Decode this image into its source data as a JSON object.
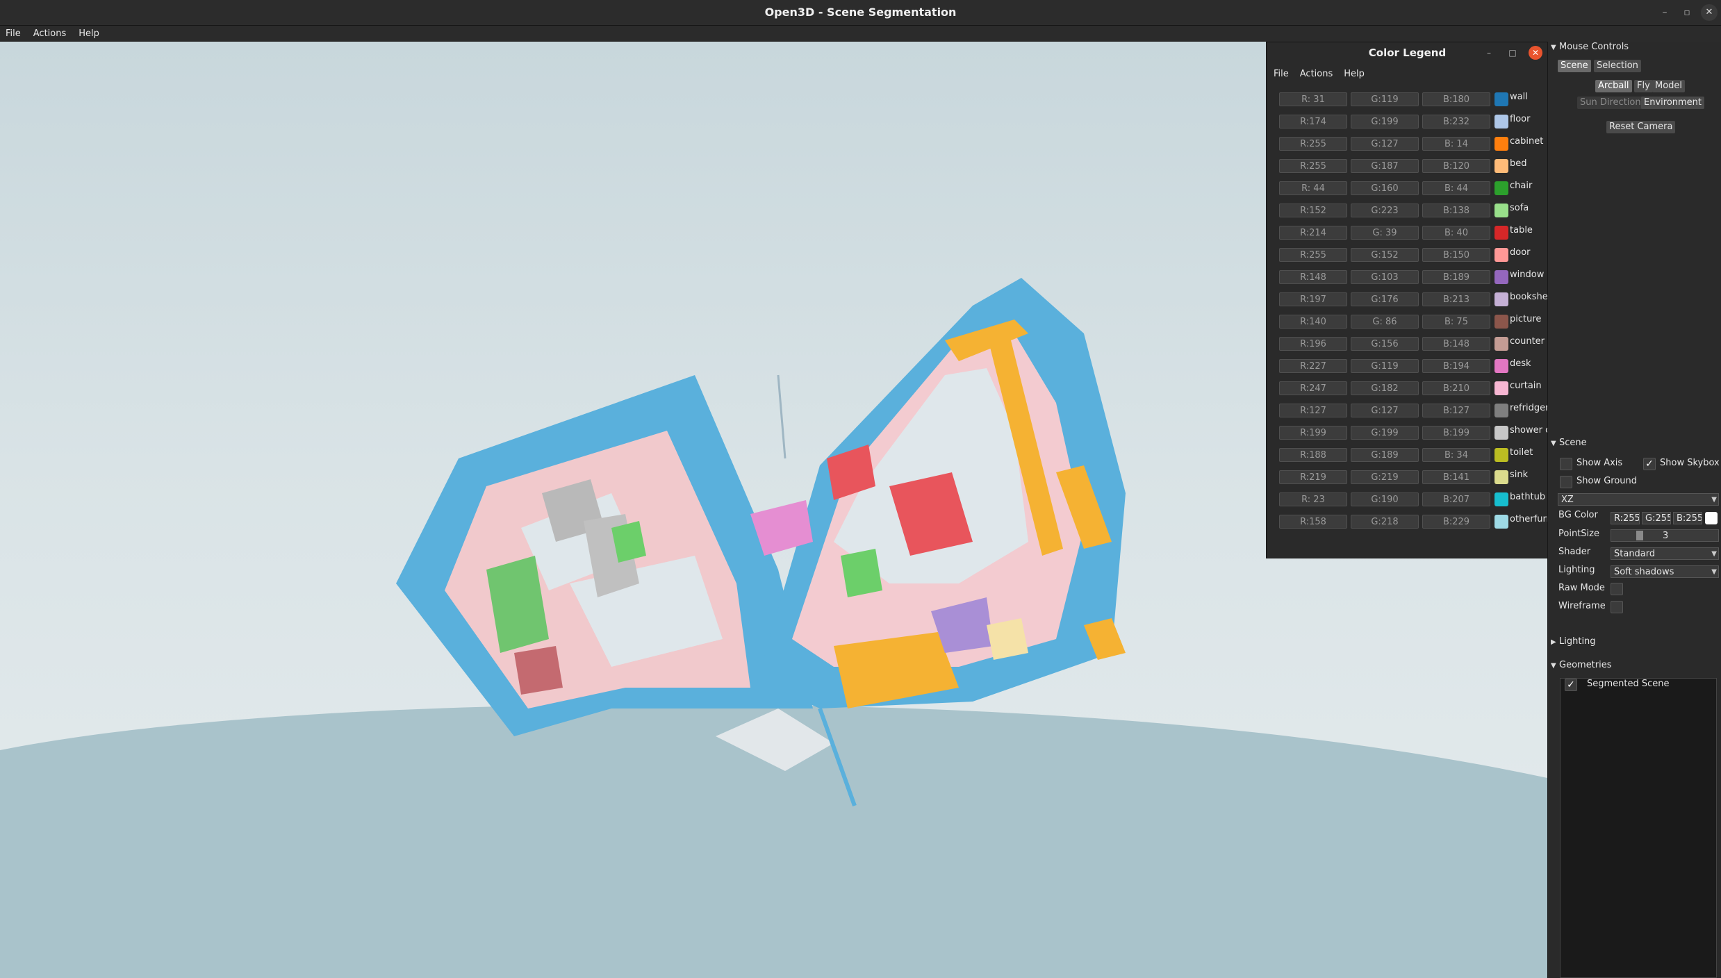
{
  "window": {
    "title": "Open3D - Scene Segmentation",
    "minimize": "–",
    "maximize": "▫",
    "close": "✕"
  },
  "menubar": {
    "file": "File",
    "actions": "Actions",
    "help": "Help"
  },
  "legend": {
    "title": "Color Legend",
    "menu": {
      "file": "File",
      "actions": "Actions",
      "help": "Help"
    },
    "minimize": "–",
    "maximize": "□",
    "close": "✕",
    "entries": [
      {
        "r": "R: 31",
        "g": "G:119",
        "b": "B:180",
        "label": "wall",
        "color": "#1f77b4"
      },
      {
        "r": "R:174",
        "g": "G:199",
        "b": "B:232",
        "label": "floor",
        "color": "#aec7e8"
      },
      {
        "r": "R:255",
        "g": "G:127",
        "b": "B: 14",
        "label": "cabinet",
        "color": "#ff7f0e"
      },
      {
        "r": "R:255",
        "g": "G:187",
        "b": "B:120",
        "label": "bed",
        "color": "#ffbb78"
      },
      {
        "r": "R: 44",
        "g": "G:160",
        "b": "B: 44",
        "label": "chair",
        "color": "#2ca02c"
      },
      {
        "r": "R:152",
        "g": "G:223",
        "b": "B:138",
        "label": "sofa",
        "color": "#98df8a"
      },
      {
        "r": "R:214",
        "g": "G: 39",
        "b": "B: 40",
        "label": "table",
        "color": "#d62728"
      },
      {
        "r": "R:255",
        "g": "G:152",
        "b": "B:150",
        "label": "door",
        "color": "#ff9896"
      },
      {
        "r": "R:148",
        "g": "G:103",
        "b": "B:189",
        "label": "window",
        "color": "#9467bd"
      },
      {
        "r": "R:197",
        "g": "G:176",
        "b": "B:213",
        "label": "bookshelf",
        "color": "#c5b0d5"
      },
      {
        "r": "R:140",
        "g": "G: 86",
        "b": "B: 75",
        "label": "picture",
        "color": "#8c564b"
      },
      {
        "r": "R:196",
        "g": "G:156",
        "b": "B:148",
        "label": "counter",
        "color": "#c49c94"
      },
      {
        "r": "R:227",
        "g": "G:119",
        "b": "B:194",
        "label": "desk",
        "color": "#e377c2"
      },
      {
        "r": "R:247",
        "g": "G:182",
        "b": "B:210",
        "label": "curtain",
        "color": "#f7b6d2"
      },
      {
        "r": "R:127",
        "g": "G:127",
        "b": "B:127",
        "label": "refridgerator",
        "color": "#7f7f7f"
      },
      {
        "r": "R:199",
        "g": "G:199",
        "b": "B:199",
        "label": "shower curtain",
        "color": "#c7c7c7"
      },
      {
        "r": "R:188",
        "g": "G:189",
        "b": "B: 34",
        "label": "toilet",
        "color": "#bcbd22"
      },
      {
        "r": "R:219",
        "g": "G:219",
        "b": "B:141",
        "label": "sink",
        "color": "#dbdb8d"
      },
      {
        "r": "R: 23",
        "g": "G:190",
        "b": "B:207",
        "label": "bathtub",
        "color": "#17becf"
      },
      {
        "r": "R:158",
        "g": "G:218",
        "b": "B:229",
        "label": "otherfurniture",
        "color": "#9edae5"
      }
    ]
  },
  "panel": {
    "mouse_controls": {
      "header": "Mouse Controls",
      "tab_scene": "Scene",
      "tab_selection": "Selection",
      "arcball": "Arcball",
      "fly": "Fly",
      "model": "Model",
      "sun_direction": "Sun Direction",
      "environment": "Environment",
      "reset_camera": "Reset Camera"
    },
    "scene": {
      "header": "Scene",
      "show_axis": "Show Axis",
      "show_skybox": "Show Skybox",
      "show_ground": "Show Ground",
      "ground_plane": "XZ",
      "bg_color_label": "BG Color",
      "bg_r": "R:255",
      "bg_g": "G:255",
      "bg_b": "B:255",
      "point_size_label": "PointSize",
      "point_size": "3",
      "shader_label": "Shader",
      "shader": "Standard",
      "lighting_label": "Lighting",
      "lighting": "Soft shadows",
      "raw_mode": "Raw Mode",
      "wireframe": "Wireframe",
      "show_skybox_checked": true,
      "show_axis_checked": false,
      "show_ground_checked": false
    },
    "lighting_header": "Lighting",
    "geometries": {
      "header": "Geometries",
      "items": [
        {
          "label": "Segmented Scene",
          "checked": true
        }
      ]
    }
  }
}
